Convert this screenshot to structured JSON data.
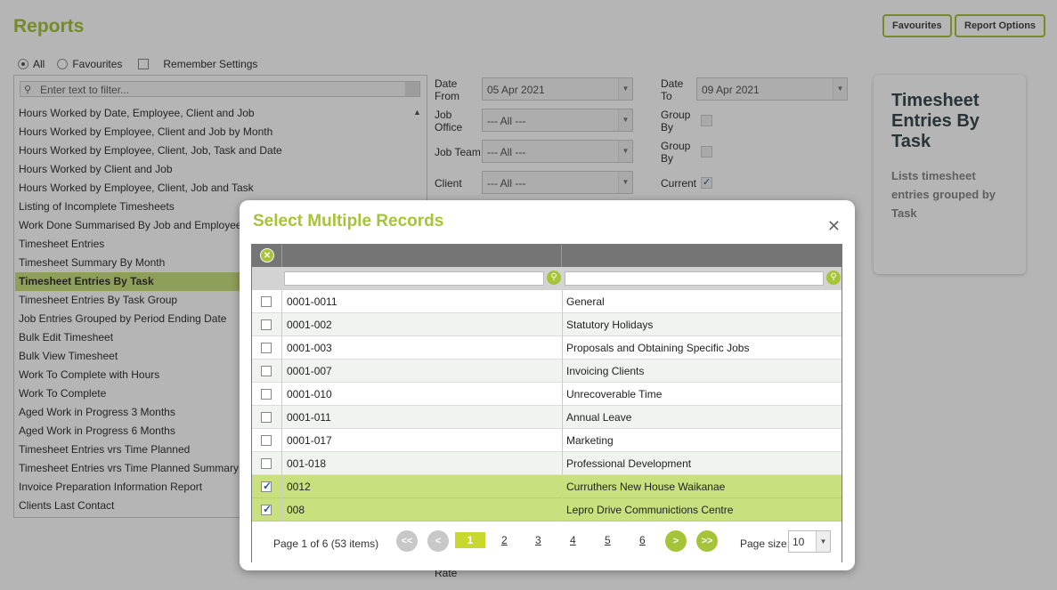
{
  "header": {
    "title": "Reports",
    "favourites_button": "Favourites",
    "report_options_button": "Report Options"
  },
  "scope": {
    "all_label": "All",
    "favourites_label": "Favourites",
    "remember_label": "Remember Settings",
    "selected": "All"
  },
  "filter": {
    "placeholder": "Enter text to filter..."
  },
  "reports": [
    "Hours Worked by Date, Employee, Client and Job",
    "Hours Worked by Employee, Client and Job by Month",
    "Hours Worked by Employee, Client, Job, Task and Date",
    "Hours Worked by Client and Job",
    "Hours Worked by Employee, Client, Job and Task",
    "Listing of Incomplete Timesheets",
    "Work Done Summarised By Job and Employee",
    "Timesheet Entries",
    "Timesheet Summary By Month",
    "Timesheet Entries By Task",
    "Timesheet Entries By Task Group",
    "Job Entries Grouped by Period Ending Date",
    "Bulk Edit Timesheet",
    "Bulk View Timesheet",
    "Work To Complete with Hours",
    "Work To Complete",
    "Aged Work in Progress 3 Months",
    "Aged Work in Progress 6 Months",
    "Timesheet Entries vrs Time Planned",
    "Timesheet Entries vrs Time Planned Summary",
    "Invoice Preparation Information Report",
    "Clients Last Contact"
  ],
  "selected_report_index": 9,
  "form": {
    "date_from_label": "Date From",
    "date_from_value": "05 Apr 2021",
    "date_to_label": "Date To",
    "date_to_value": "09 Apr 2021",
    "job_office_label": "Job Office",
    "job_office_value": "--- All ---",
    "job_team_label": "Job Team",
    "job_team_value": "--- All ---",
    "client_label": "Client",
    "client_value": "--- All ---",
    "group_by_label": "Group By",
    "group_by2_label": "Group By",
    "current_label": "Current",
    "rate_label": "Rate"
  },
  "card": {
    "title": "Timesheet Entries By Task",
    "description": "Lists timesheet entries grouped by Task"
  },
  "modal": {
    "title": "Select Multiple Records",
    "rows": [
      {
        "code": "0001-0011",
        "name": "General",
        "checked": false
      },
      {
        "code": "0001-002",
        "name": "Statutory Holidays",
        "checked": false
      },
      {
        "code": "0001-003",
        "name": "Proposals and Obtaining Specific Jobs",
        "checked": false
      },
      {
        "code": "0001-007",
        "name": "Invoicing Clients",
        "checked": false
      },
      {
        "code": "0001-010",
        "name": "Unrecoverable Time",
        "checked": false
      },
      {
        "code": "0001-011",
        "name": "Annual Leave",
        "checked": false
      },
      {
        "code": "0001-017",
        "name": "Marketing",
        "checked": false
      },
      {
        "code": "001-018",
        "name": "Professional Development",
        "checked": false
      },
      {
        "code": "0012",
        "name": "Curruthers New House Waikanae",
        "checked": true
      },
      {
        "code": "008",
        "name": "Lepro Drive Communictions Centre",
        "checked": true
      }
    ],
    "pager": {
      "info": "Page 1 of 6 (53 items)",
      "pages": [
        "1",
        "2",
        "3",
        "4",
        "5",
        "6"
      ],
      "current": "1",
      "page_size_label": "Page size:",
      "page_size": "10"
    }
  },
  "colors": {
    "accent": "#a6c437",
    "selected_row": "#c8e07e"
  }
}
